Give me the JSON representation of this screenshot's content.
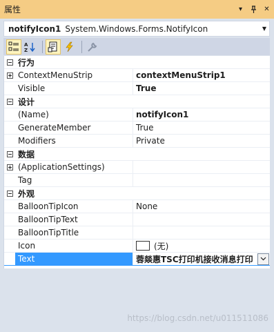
{
  "titlebar": {
    "title": "属性",
    "buttons": [
      {
        "name": "dropdown",
        "glyph": "▾"
      },
      {
        "name": "pin",
        "glyph": "⊥"
      },
      {
        "name": "close",
        "glyph": "✕"
      }
    ]
  },
  "object_selector": {
    "name": "notifyIcon1",
    "type": "System.Windows.Forms.NotifyIcon"
  },
  "toolbar": {
    "buttons": [
      "categorized-icon",
      "alphabetical-icon",
      "properties-icon",
      "events-icon",
      "property-pages-icon"
    ],
    "active": [
      "categorized-icon",
      "properties-icon"
    ]
  },
  "grid": {
    "categories": [
      {
        "label": "行为",
        "properties": [
          {
            "name": "ContextMenuStrip",
            "value": "contextMenuStrip1",
            "bold": true,
            "expandable": true
          },
          {
            "name": "Visible",
            "value": "True",
            "bold": true
          }
        ]
      },
      {
        "label": "设计",
        "properties": [
          {
            "name": "(Name)",
            "value": "notifyIcon1",
            "bold": true
          },
          {
            "name": "GenerateMember",
            "value": "True",
            "bold": false
          },
          {
            "name": "Modifiers",
            "value": "Private",
            "bold": false
          }
        ]
      },
      {
        "label": "数据",
        "properties": [
          {
            "name": "(ApplicationSettings)",
            "value": "",
            "bold": false,
            "expandable": true
          },
          {
            "name": "Tag",
            "value": "",
            "bold": false
          }
        ]
      },
      {
        "label": "外观",
        "properties": [
          {
            "name": "BalloonTipIcon",
            "value": "None",
            "bold": false
          },
          {
            "name": "BalloonTipText",
            "value": "",
            "bold": false
          },
          {
            "name": "BalloonTipTitle",
            "value": "",
            "bold": false
          },
          {
            "name": "Icon",
            "value": "(无)",
            "bold": false,
            "swatch": true
          },
          {
            "name": "Text",
            "value": "蓉燚惠TSC打印机接收消息打印",
            "bold": true,
            "selected": true,
            "dropdown": true
          }
        ]
      }
    ]
  },
  "watermark": "https://blog.csdn.net/u011511086",
  "colors": {
    "titlebar": "#f5cc84",
    "selection": "#3399ff",
    "toolbar": "#cfd6e5",
    "background": "#dbe2ec"
  }
}
